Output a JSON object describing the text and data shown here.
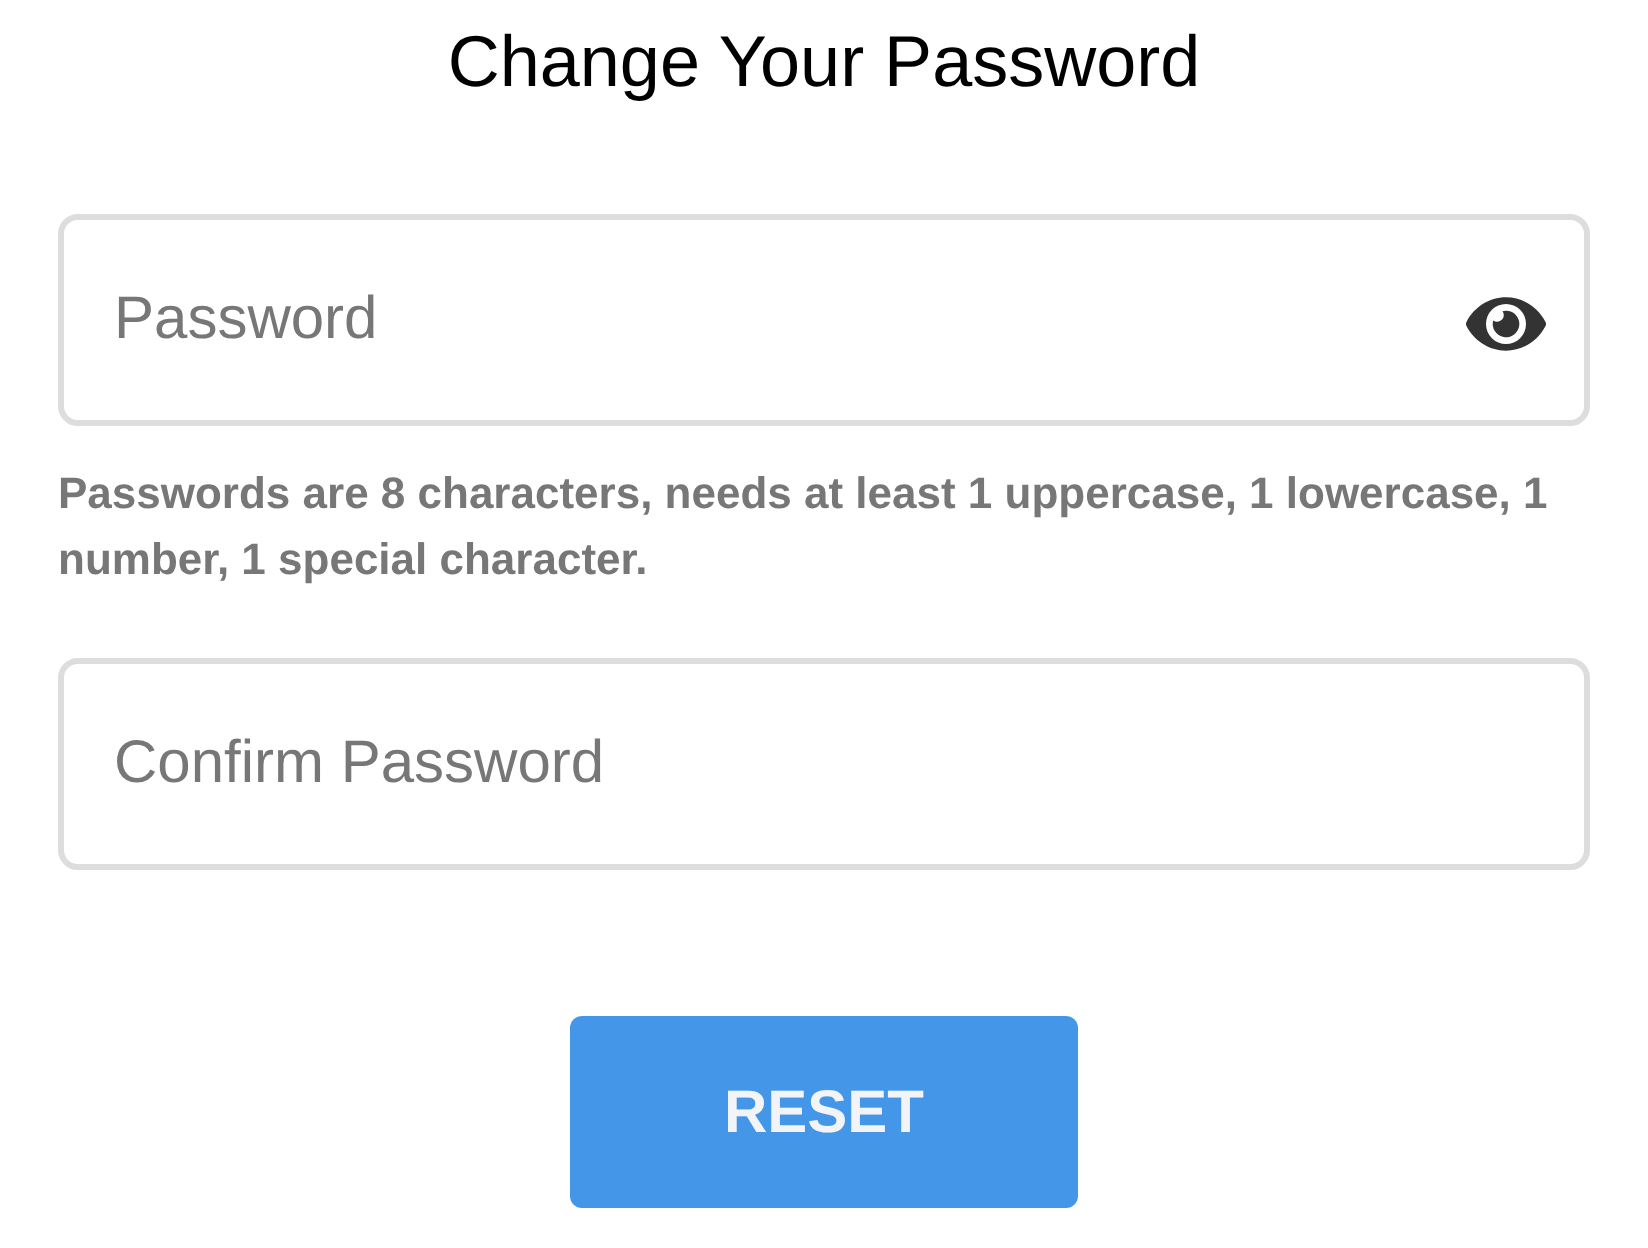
{
  "title": "Change Your Password",
  "fields": [
    {
      "placeholder": "Password",
      "reveal_toggle": true,
      "hint": "Passwords are 8 characters, needs at least 1 uppercase, 1 lowercase, 1 number, 1 special character."
    },
    {
      "placeholder": "Confirm Password",
      "reveal_toggle": false
    }
  ],
  "button": {
    "label": "RESET"
  }
}
